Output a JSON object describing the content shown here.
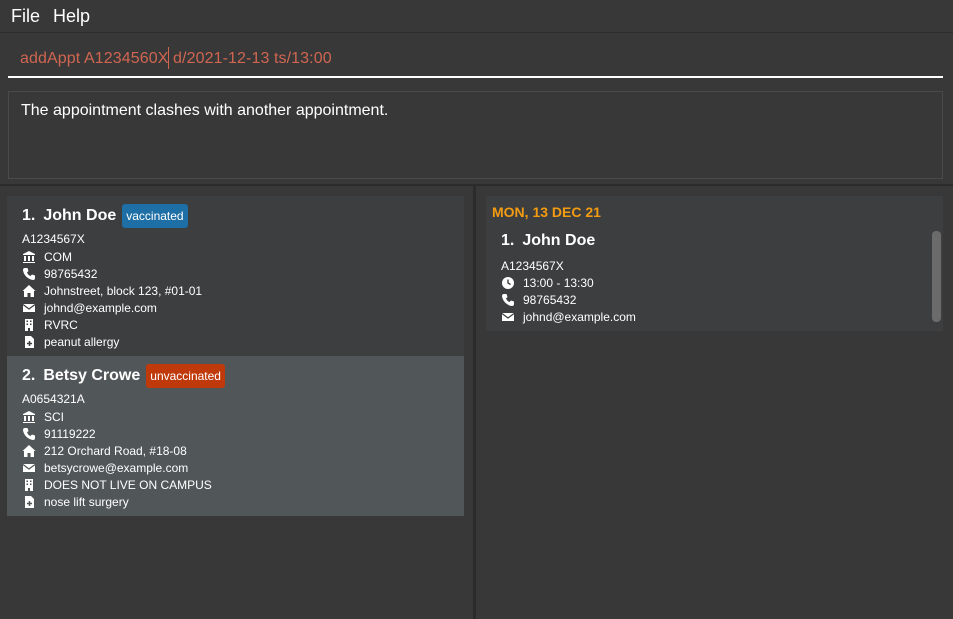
{
  "menu": {
    "file": "File",
    "help": "Help"
  },
  "command": {
    "value": "addAppt A1234560X d/2021-12-13 ts/13:00"
  },
  "result": {
    "message": "The appointment clashes with another appointment."
  },
  "persons": [
    {
      "index": "1.",
      "name": "John Doe",
      "tag": "vaccinated",
      "matric": "A1234567X",
      "faculty": "COM",
      "phone": "98765432",
      "address": "Johnstreet, block 123, #01-01",
      "email": "johnd@example.com",
      "residence": "RVRC",
      "medical": "peanut allergy"
    },
    {
      "index": "2.",
      "name": "Betsy Crowe",
      "tag": "unvaccinated",
      "matric": "A0654321A",
      "faculty": "SCI",
      "phone": "91119222",
      "address": "212 Orchard Road, #18-08",
      "email": "betsycrowe@example.com",
      "residence": "DOES NOT LIVE ON CAMPUS",
      "medical": "nose lift surgery"
    }
  ],
  "appointment": {
    "date": "MON, 13 DEC 21",
    "index": "1.",
    "name": "John Doe",
    "matric": "A1234567X",
    "time": "13:00 - 13:30",
    "phone": "98765432",
    "email": "johnd@example.com"
  },
  "colors": {
    "background": "#383838",
    "vaccinated": "#1d6fa5",
    "unvaccinated": "#c0390b",
    "date_accent": "#f39c12",
    "command_error": "#d06651"
  }
}
